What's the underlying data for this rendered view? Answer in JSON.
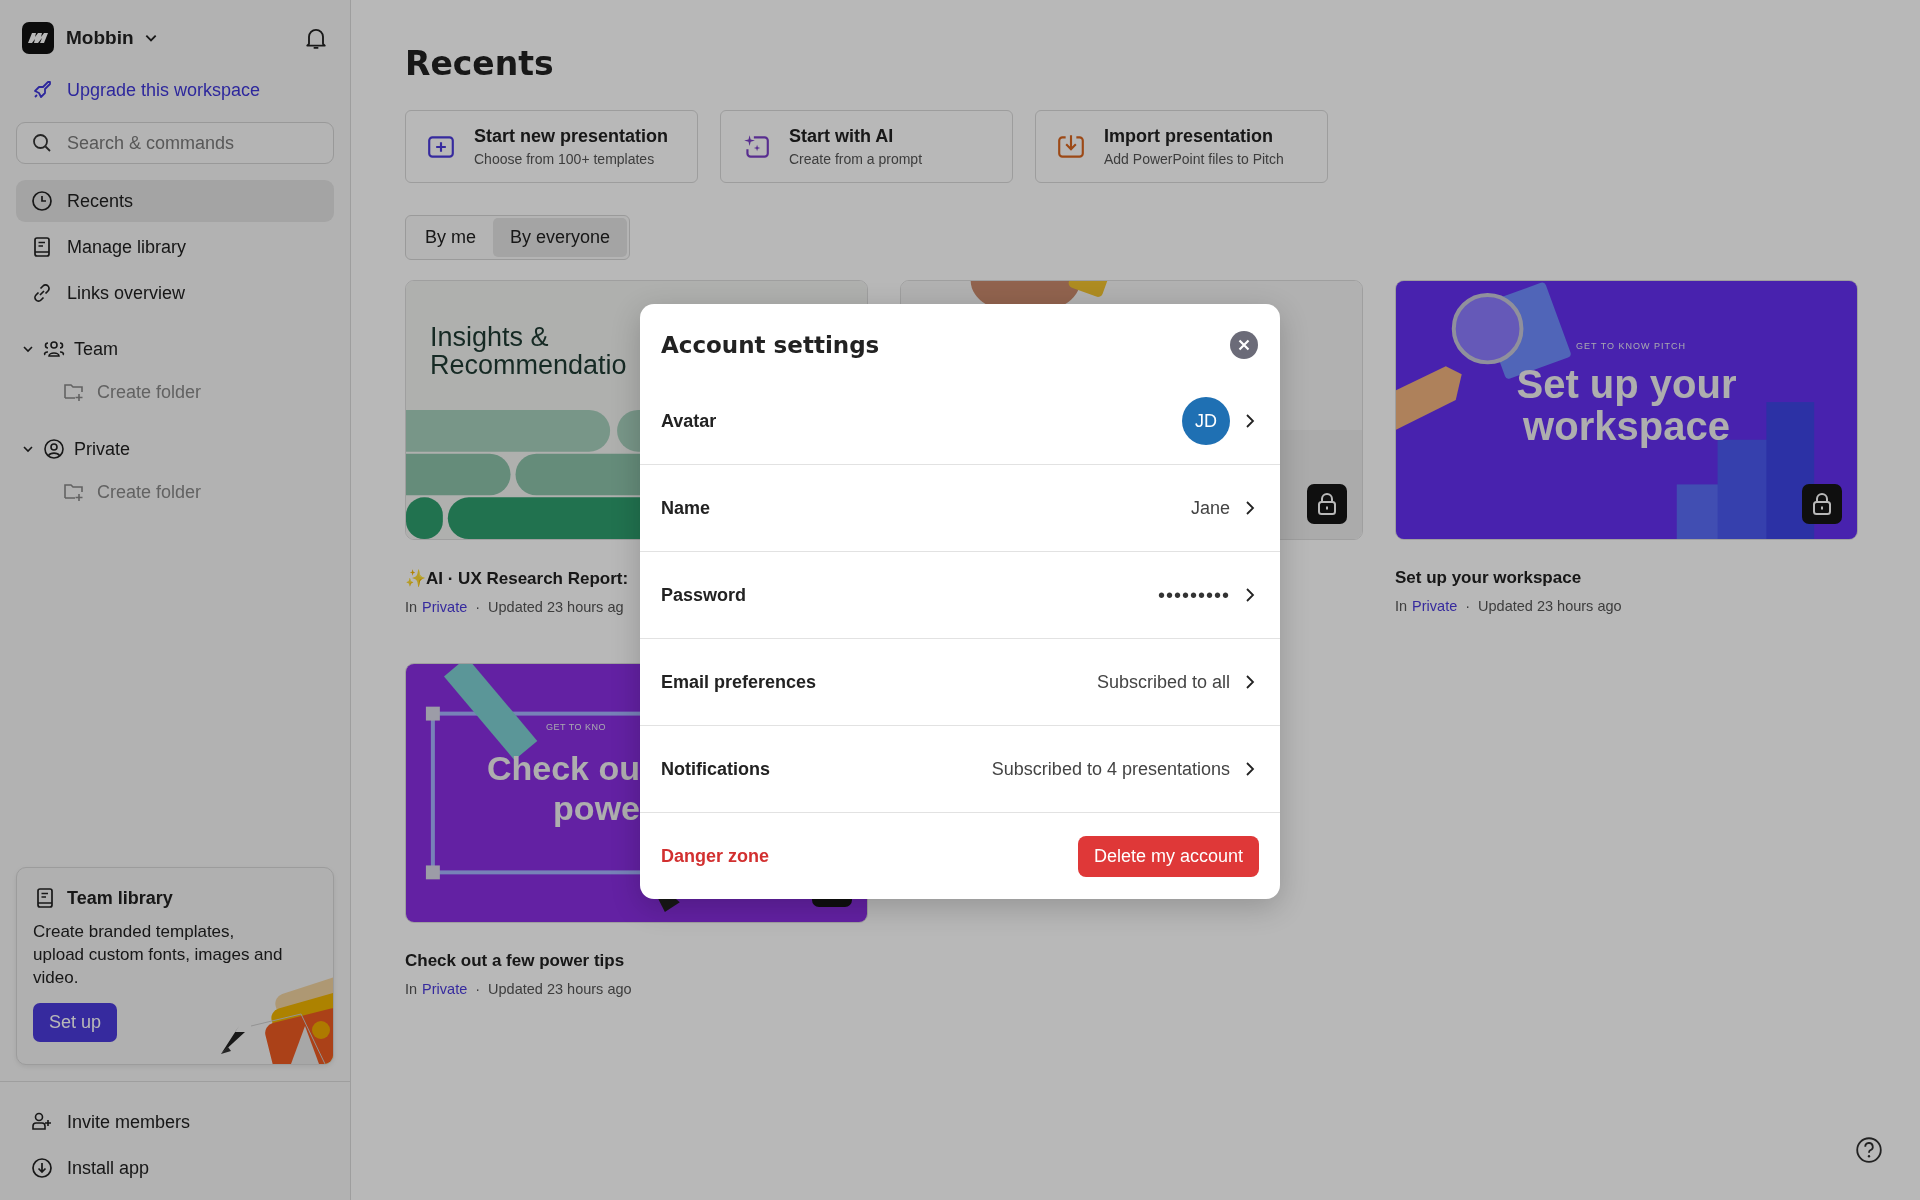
{
  "sidebar": {
    "workspace": {
      "name": "Mobbin"
    },
    "upgrade_link": "Upgrade this workspace",
    "search": {
      "placeholder": "Search & commands"
    },
    "nav": [
      {
        "label": "Recents",
        "selected": true
      },
      {
        "label": "Manage library",
        "selected": false
      },
      {
        "label": "Links overview",
        "selected": false
      }
    ],
    "sections": [
      {
        "label": "Team",
        "expanded": true,
        "children": [
          {
            "label": "Create folder"
          }
        ]
      },
      {
        "label": "Private",
        "expanded": true,
        "children": [
          {
            "label": "Create folder"
          }
        ]
      }
    ],
    "promo": {
      "title": "Team library",
      "text": "Create branded templates, upload custom fonts, images and video.",
      "button": "Set up"
    },
    "footer": [
      {
        "label": "Invite members"
      },
      {
        "label": "Install app"
      }
    ]
  },
  "main": {
    "title": "Recents",
    "actions": [
      {
        "title": "Start new presentation",
        "subtitle": "Choose from 100+ templates"
      },
      {
        "title": "Start with AI",
        "subtitle": "Create from a prompt"
      },
      {
        "title": "Import presentation",
        "subtitle": "Add PowerPoint files to Pitch"
      }
    ],
    "filter_tabs": [
      {
        "label": "By me",
        "selected": false
      },
      {
        "label": "By everyone",
        "selected": true
      }
    ],
    "cards": [
      {
        "kind": "insights",
        "thumb_text": [
          "Insights &",
          "Recommendatio"
        ],
        "locked": false,
        "title": "✨AI · UX Research Report:",
        "location_prefix": "In",
        "location": "Private",
        "separator": "·",
        "updated": "Updated 23 hours ag"
      },
      {
        "kind": "hands",
        "locked": true
      },
      {
        "kind": "workspace",
        "thumb_caption": "GET TO KNOW PITCH",
        "thumb_text": [
          "Set up your",
          "workspace"
        ],
        "locked": true,
        "title": "Set up your workspace",
        "location_prefix": "In",
        "location": "Private",
        "separator": "·",
        "updated": "Updated 23 hours ago"
      },
      {
        "kind": "tips",
        "thumb_caption": "GET TO KNO",
        "thumb_text": [
          "Check ou",
          "powe"
        ],
        "locked": true,
        "title": "Check out a few power tips",
        "location_prefix": "In",
        "location": "Private",
        "separator": "·",
        "updated": "Updated 23 hours ago"
      }
    ]
  },
  "modal": {
    "title": "Account settings",
    "rows": [
      {
        "kind": "avatar",
        "label": "Avatar",
        "value": "JD"
      },
      {
        "kind": "text",
        "label": "Name",
        "value": "Jane"
      },
      {
        "kind": "password",
        "label": "Password",
        "value": "•••••••••"
      },
      {
        "kind": "text",
        "label": "Email preferences",
        "value": "Subscribed to all"
      },
      {
        "kind": "text",
        "label": "Notifications",
        "value": "Subscribed to 4 presentations"
      }
    ],
    "danger": {
      "label": "Danger zone",
      "button": "Delete my account"
    }
  }
}
